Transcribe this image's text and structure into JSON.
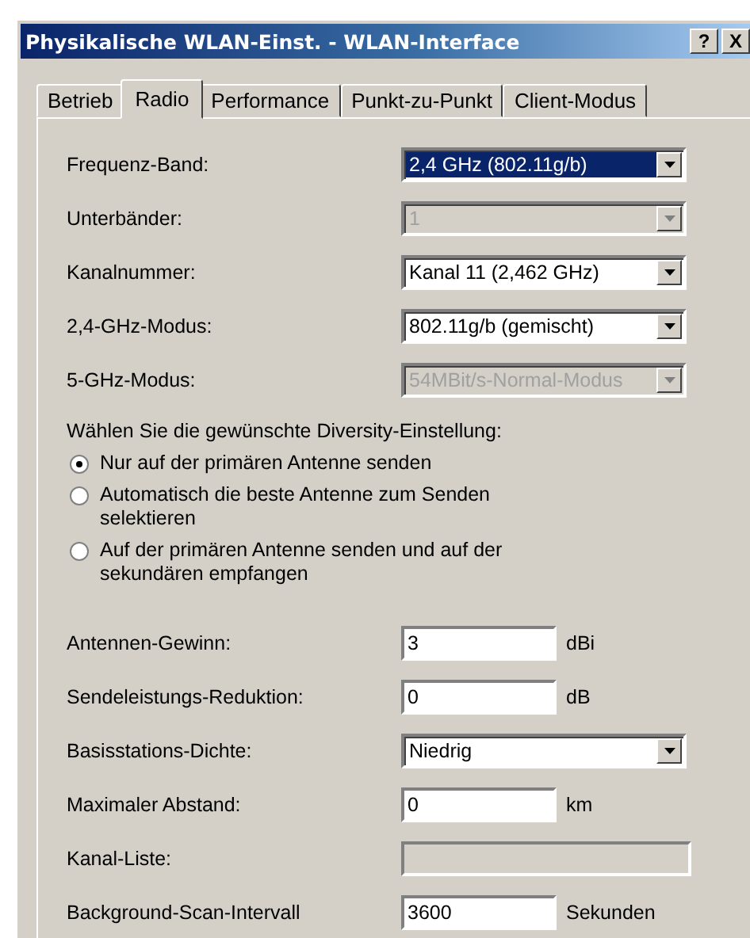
{
  "window": {
    "title": "Physikalische WLAN-Einst. - WLAN-Interface",
    "buttons": [
      "?",
      "X"
    ]
  },
  "tabs": [
    {
      "label": "Betrieb",
      "selected": false
    },
    {
      "label": "Radio",
      "selected": true
    },
    {
      "label": "Performance",
      "selected": false
    },
    {
      "label": "Punkt-zu-Punkt",
      "selected": false
    },
    {
      "label": "Client-Modus",
      "selected": false
    }
  ],
  "top_fields": [
    {
      "kind": "combo",
      "label": "Frequenz-Band:",
      "value": "2,4 GHz (802.11g/b)",
      "disabled": false,
      "focused": true
    },
    {
      "kind": "combo",
      "label": "Unterbänder:",
      "value": "1",
      "disabled": true,
      "focused": false
    },
    {
      "kind": "combo",
      "label": "Kanalnummer:",
      "value": "Kanal 11 (2,462 GHz)",
      "disabled": false,
      "focused": false
    },
    {
      "kind": "combo",
      "label": "2,4-GHz-Modus:",
      "value": "802.11g/b (gemischt)",
      "disabled": false,
      "focused": false
    },
    {
      "kind": "combo",
      "label": "5-GHz-Modus:",
      "value": "54MBit/s-Normal-Modus",
      "disabled": true,
      "focused": false
    }
  ],
  "diversity": {
    "prompt": "Wählen Sie die gewünschte Diversity-Einstellung:",
    "options": [
      {
        "label": "Nur auf der primären Antenne senden",
        "selected": true
      },
      {
        "label": "Automatisch die beste Antenne zum Senden selektieren",
        "selected": false
      },
      {
        "label": "Auf der primären Antenne senden und auf der sekundären empfangen",
        "selected": false
      }
    ]
  },
  "bottom_fields": [
    {
      "kind": "text",
      "label": "Antennen-Gewinn:",
      "value": "3",
      "unit": "dBi",
      "disabled": false
    },
    {
      "kind": "text",
      "label": "Sendeleistungs-Reduktion:",
      "value": "0",
      "unit": "dB",
      "disabled": false
    },
    {
      "kind": "combo",
      "label": "Basisstations-Dichte:",
      "value": "Niedrig",
      "disabled": false
    },
    {
      "kind": "text",
      "label": "Maximaler Abstand:",
      "value": "0",
      "unit": "km",
      "disabled": false
    },
    {
      "kind": "wide",
      "label": "Kanal-Liste:",
      "disabled": true
    },
    {
      "kind": "text",
      "label": "Background-Scan-Intervall",
      "value": "3600",
      "unit": "Sekunden",
      "disabled": false
    }
  ]
}
